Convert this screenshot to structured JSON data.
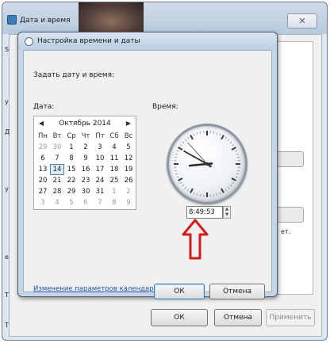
{
  "outer": {
    "title": "Дата и время",
    "close_glyph": "✕",
    "snippets": [
      "S",
      "у",
      "Д",
      "у",
      "е",
      "ет.",
      "Т",
      "Т"
    ],
    "buttons": {
      "ok": "ОК",
      "cancel": "Отмена",
      "apply": "Применить"
    }
  },
  "dialog": {
    "title": "Настройка времени и даты",
    "prompt": "Задать дату и время:",
    "date_label": "Дата:",
    "time_label": "Время:",
    "calendar": {
      "month": "Октябрь 2014",
      "prev_glyph": "◀",
      "next_glyph": "▶",
      "weekdays": [
        "Пн",
        "Вт",
        "Ср",
        "Чт",
        "Пт",
        "Сб",
        "Вс"
      ],
      "weeks": [
        [
          "29",
          "30",
          "1",
          "2",
          "3",
          "4",
          "5"
        ],
        [
          "6",
          "7",
          "8",
          "9",
          "10",
          "11",
          "12"
        ],
        [
          "13",
          "14",
          "15",
          "16",
          "17",
          "18",
          "19"
        ],
        [
          "20",
          "21",
          "22",
          "23",
          "24",
          "25",
          "26"
        ],
        [
          "27",
          "28",
          "29",
          "30",
          "31",
          "1",
          "2"
        ],
        [
          "3",
          "4",
          "5",
          "6",
          "7",
          "8",
          "9"
        ]
      ],
      "selected": "14"
    },
    "clock": {
      "hour": 8,
      "minute": 49,
      "second": 53
    },
    "time_value": "8:49:53",
    "calendar_link": "Изменение параметров календаря",
    "buttons": {
      "ok": "ОК",
      "cancel": "Отмена"
    },
    "spin_up": "▲",
    "spin_down": "▼"
  },
  "colors": {
    "annotation_arrow": "#d01c1c",
    "link": "#1f55b3",
    "selected_day": "#dbe8f5"
  }
}
